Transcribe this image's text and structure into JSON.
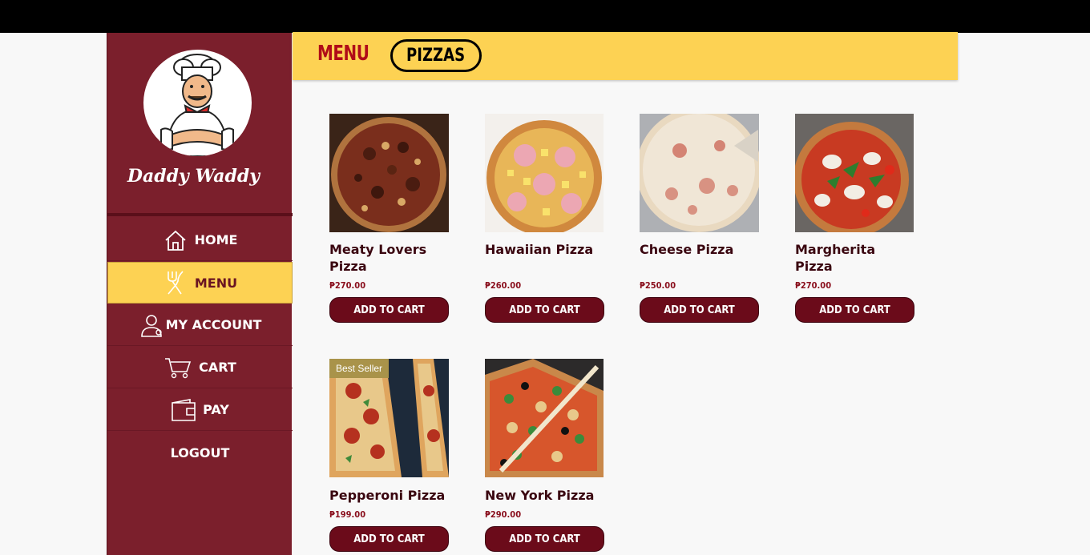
{
  "brand": {
    "name": "Daddy Waddy"
  },
  "sidebar": {
    "items": [
      {
        "label": "HOME",
        "icon": "home-icon"
      },
      {
        "label": "MENU",
        "icon": "utensils-icon",
        "active": true
      },
      {
        "label": "MY ACCOUNT",
        "icon": "user-icon"
      },
      {
        "label": "CART",
        "icon": "cart-icon"
      },
      {
        "label": "PAY",
        "icon": "wallet-icon"
      },
      {
        "label": "LOGOUT",
        "icon": ""
      }
    ]
  },
  "header": {
    "title": "MENU",
    "tab": "PIZZAS"
  },
  "products": [
    {
      "name": "Meaty Lovers Pizza",
      "price": "₱270.00",
      "button": "ADD TO CART",
      "badge": ""
    },
    {
      "name": "Hawaiian Pizza",
      "price": "₱260.00",
      "button": "ADD TO CART",
      "badge": ""
    },
    {
      "name": "Cheese Pizza",
      "price": "₱250.00",
      "button": "ADD TO CART",
      "badge": ""
    },
    {
      "name": "Margherita Pizza",
      "price": "₱270.00",
      "button": "ADD TO CART",
      "badge": ""
    },
    {
      "name": "Pepperoni Pizza",
      "price": "₱199.00",
      "button": "ADD TO CART",
      "badge": "Best Seller"
    },
    {
      "name": "New York Pizza",
      "price": "₱290.00",
      "button": "ADD TO CART",
      "badge": ""
    }
  ],
  "colors": {
    "sidebar": "#7b1f2c",
    "accent": "#fdd253",
    "button": "#6b0b1a",
    "price": "#8a0f1d"
  }
}
